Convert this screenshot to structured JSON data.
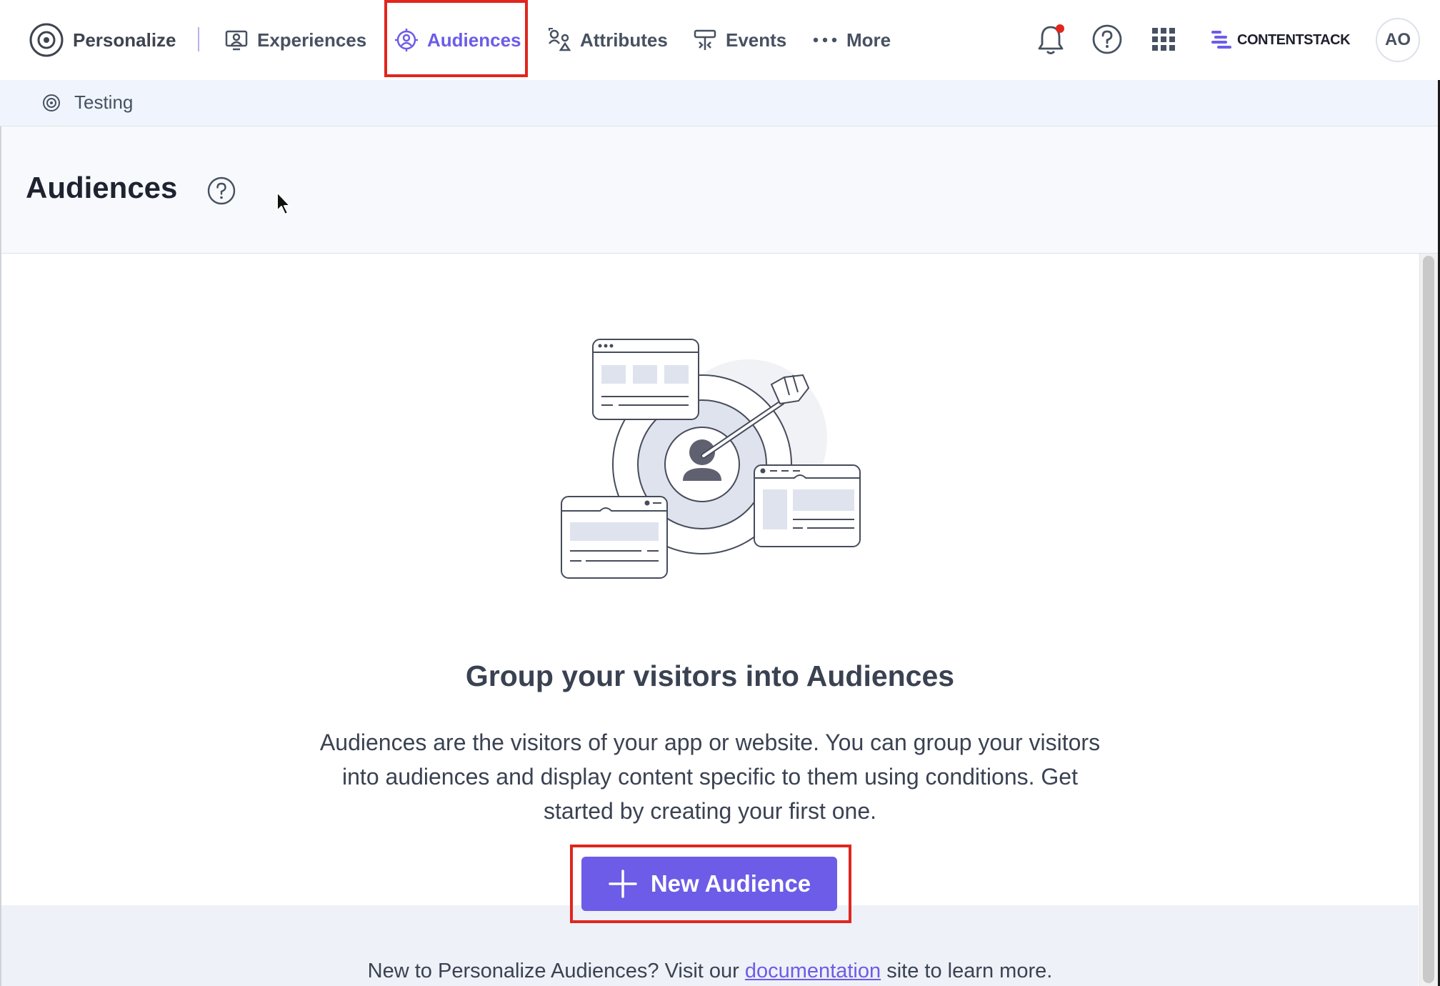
{
  "nav": {
    "brand_label": "Personalize",
    "items": [
      {
        "label": "Experiences",
        "icon": "experiences-icon"
      },
      {
        "label": "Audiences",
        "icon": "audiences-icon",
        "active": true
      },
      {
        "label": "Attributes",
        "icon": "attributes-icon"
      },
      {
        "label": "Events",
        "icon": "events-icon"
      },
      {
        "label": "More",
        "icon": "more-dots-icon"
      }
    ],
    "logo_text": "CONTENTSTACK",
    "avatar_initials": "AO"
  },
  "project": {
    "name": "Testing"
  },
  "page": {
    "title": "Audiences"
  },
  "empty_state": {
    "heading": "Group your visitors into Audiences",
    "description_lines": [
      "Audiences are the visitors of your app or website. You can group your visitors",
      "into audiences and display content specific to them using conditions. Get",
      "started by creating your first one."
    ],
    "button_label": "New Audience",
    "footer_prefix": "New to Personalize Audiences? Visit our",
    "footer_link": "documentation",
    "footer_suffix": "site to learn more."
  },
  "colors": {
    "accent": "#6c5ce7",
    "highlight": "#e0261e",
    "notification_dot": "#e0261e",
    "text": "#475161"
  }
}
